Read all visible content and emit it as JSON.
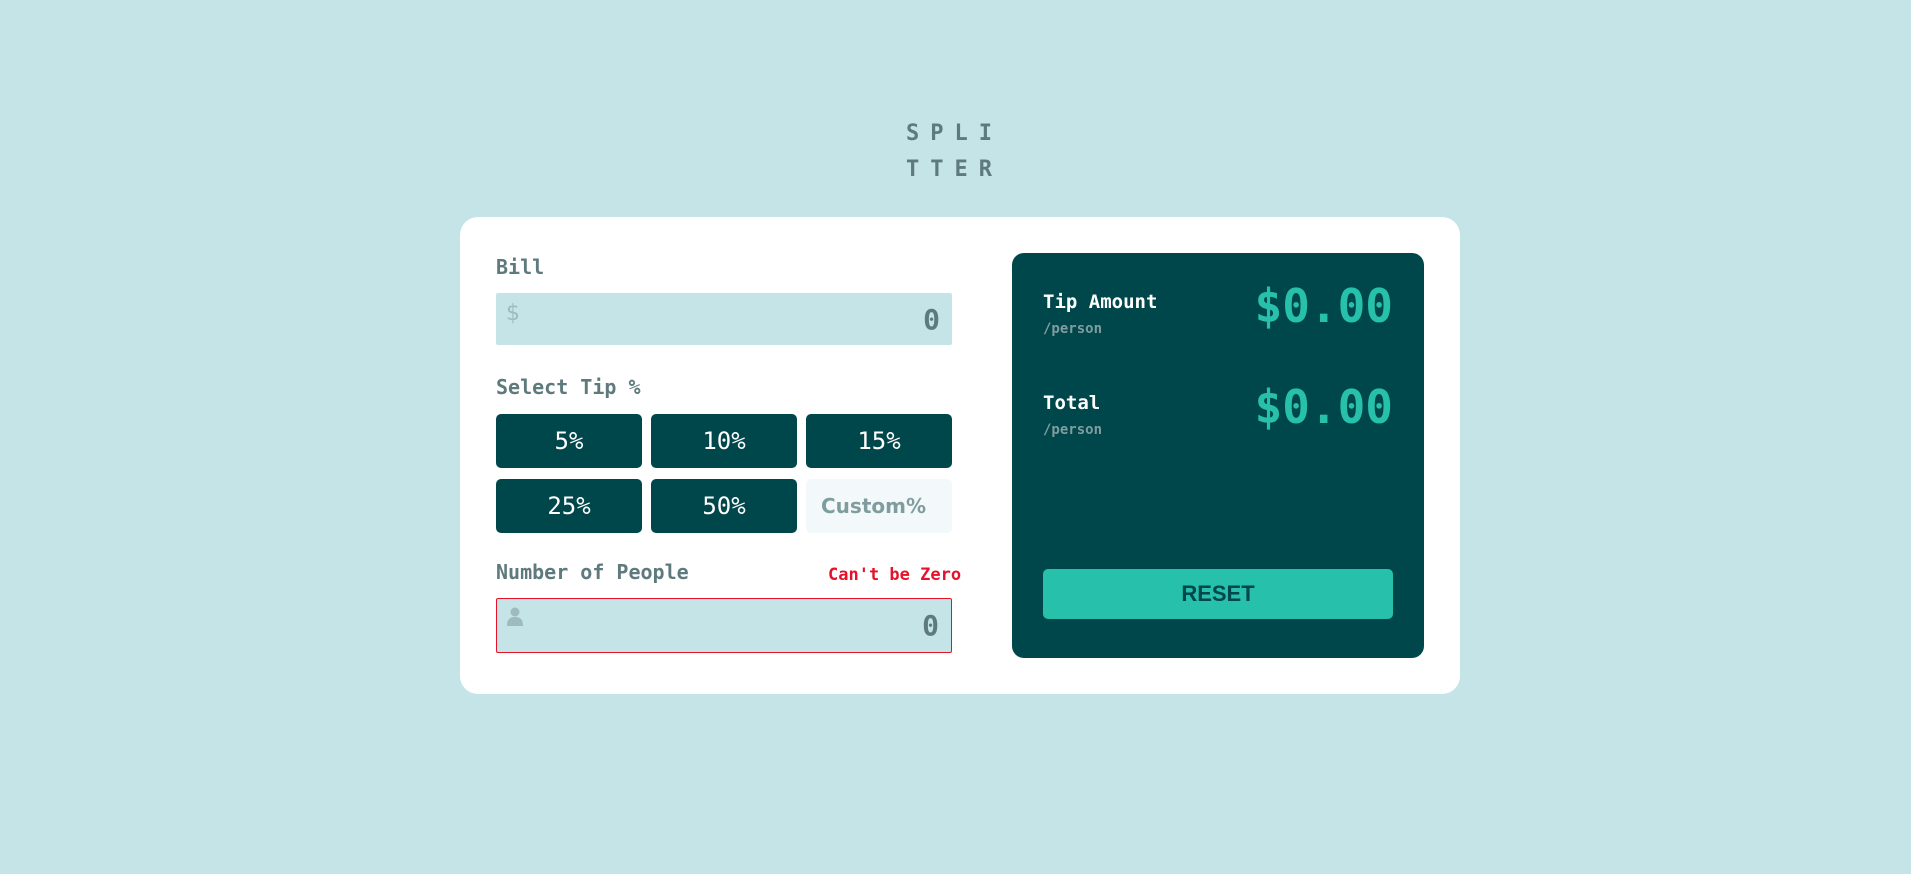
{
  "logo": {
    "text": "SPLITTER"
  },
  "bill": {
    "label": "Bill",
    "icon": "dollar-icon",
    "icon_glyph": "$",
    "value": "0"
  },
  "tip": {
    "label": "Select Tip %",
    "options": [
      "5%",
      "10%",
      "15%",
      "25%",
      "50%"
    ],
    "custom_placeholder": "Custom%"
  },
  "people": {
    "label": "Number of People",
    "error": "Can't be Zero",
    "icon": "person-icon",
    "value": "0"
  },
  "results": {
    "tip_title": "Tip Amount",
    "tip_sub": "/person",
    "tip_value": "$0.00",
    "total_title": "Total",
    "total_sub": "/person",
    "total_value": "$0.00",
    "reset_label": "RESET"
  },
  "colors": {
    "background": "#c5e4e7",
    "dark_cyan": "#00474b",
    "strong_cyan": "#26c0ab",
    "error": "#e4132a"
  }
}
